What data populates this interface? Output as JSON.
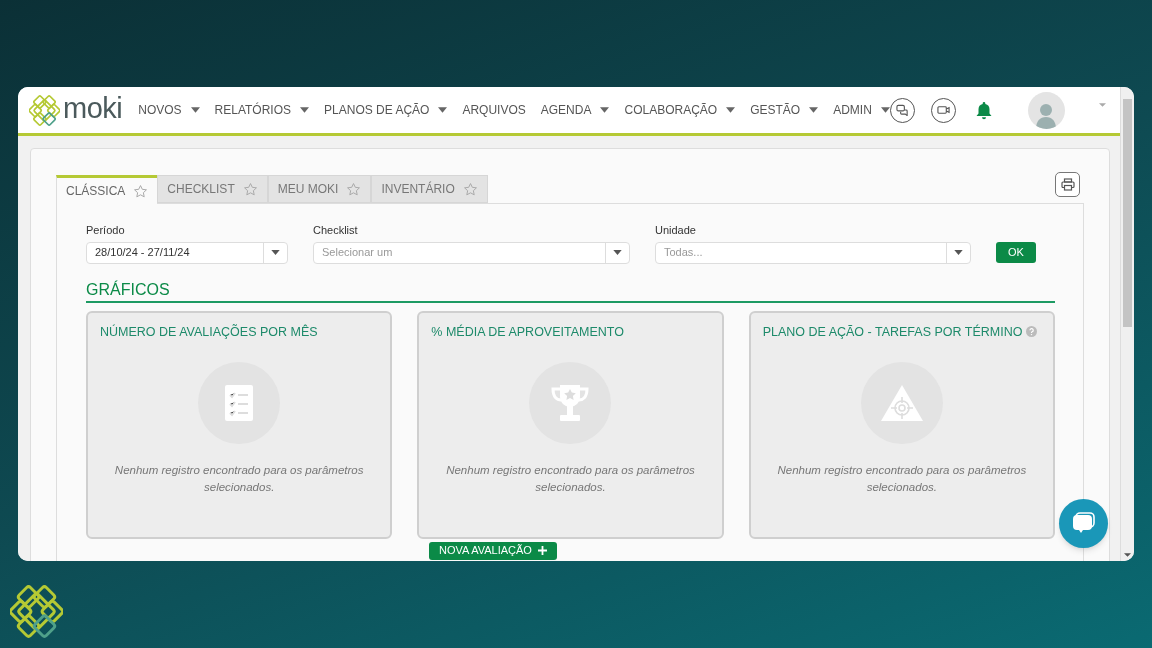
{
  "brand": {
    "name": "moki"
  },
  "nav": [
    {
      "label": "NOVOS",
      "dropdown": true
    },
    {
      "label": "RELATÓRIOS",
      "dropdown": true
    },
    {
      "label": "PLANOS DE AÇÃO",
      "dropdown": true
    },
    {
      "label": "ARQUIVOS",
      "dropdown": false
    },
    {
      "label": "AGENDA",
      "dropdown": true
    },
    {
      "label": "COLABORAÇÃO",
      "dropdown": true
    },
    {
      "label": "GESTÃO",
      "dropdown": true
    },
    {
      "label": "ADMIN",
      "dropdown": true
    }
  ],
  "tabs": [
    {
      "label": "CLÁSSICA",
      "selected": true
    },
    {
      "label": "CHECKLIST",
      "selected": false
    },
    {
      "label": "MEU MOKI",
      "selected": false
    },
    {
      "label": "INVENTÁRIO",
      "selected": false
    }
  ],
  "filters": [
    {
      "label": "Período",
      "value": "28/10/24 - 27/11/24"
    },
    {
      "label": "Checklist",
      "placeholder": "Selecionar um"
    },
    {
      "label": "Unidade",
      "placeholder": "Todas..."
    }
  ],
  "ok_button": "OK",
  "section_title": "GRÁFICOS",
  "cards": [
    {
      "title": "NÚMERO DE AVALIAÇÕES POR MÊS",
      "kind": "checklist",
      "help": false,
      "message": "Nenhum registro encontrado para os parâmetros selecionados."
    },
    {
      "title": "% MÉDIA DE APROVEITAMENTO",
      "kind": "trophy",
      "help": false,
      "message": "Nenhum registro encontrado para os parâmetros selecionados."
    },
    {
      "title": "PLANO DE AÇÃO - TAREFAS POR TÉRMINO",
      "kind": "target",
      "help": true,
      "message": "Nenhum registro encontrado para os parâmetros selecionados."
    }
  ],
  "new_button": "NOVA AVALIAÇÃO"
}
